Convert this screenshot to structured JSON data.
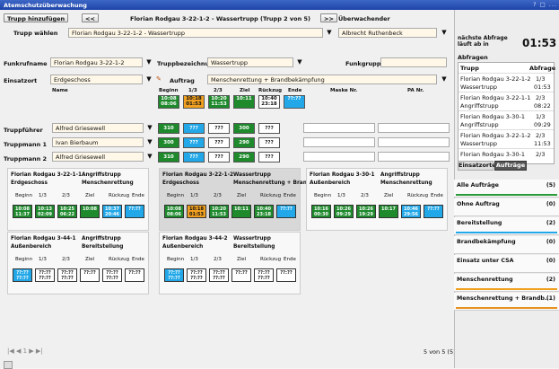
{
  "titlebar": {
    "title": "Atemschutzüberwachung",
    "controls": "? □ ..."
  },
  "toolbar": {
    "add_troop": "Trupp hinzufügen",
    "prev": "<<",
    "next": ">>",
    "current": "Florian Rodgau 3-22-1-2 - Wassertrupp (Trupp 2 von 5)",
    "monitor_label": "Überwachender"
  },
  "select": {
    "label": "Trupp wählen",
    "value": "Florian Rodgau 3-22-1-2 - Wassertrupp",
    "monitor": "Albrecht Ruthenbeck"
  },
  "form": {
    "funkrufname_label": "Funkrufname",
    "funkrufname": "Florian Rodgau 3-22-1-2",
    "truppbez_label": "Truppbezeichnung",
    "truppbez": "Wassertrupp",
    "funkgruppe_label": "Funkgruppe",
    "funkgruppe": "",
    "einsatzort_label": "Einsatzort",
    "einsatzort": "Erdgeschoss",
    "auftrag_label": "Auftrag",
    "auftrag": "Menschenrettung + Brandbekämpfung"
  },
  "table_header": {
    "name": "Name",
    "beginn": "Beginn",
    "c13": "1/3",
    "c23": "2/3",
    "ziel": "Ziel",
    "rueckzug": "Rückzug",
    "ende": "Ende",
    "maske": "Maske Nr.",
    "pa": "PA Nr."
  },
  "members": [
    {
      "role": "Truppführer",
      "name": "Alfred Griesewell",
      "value": "310",
      "cells": [
        "???",
        "???",
        "300",
        "???"
      ]
    },
    {
      "role": "Truppmann 1",
      "name": "Ivan Bierbaum",
      "value": "300",
      "cells": [
        "???",
        "???",
        "290",
        "???"
      ]
    },
    {
      "role": "Truppmann 2",
      "name": "Alfred Griesewell",
      "value": "310",
      "cells": [
        "???",
        "???",
        "290",
        "???"
      ]
    }
  ],
  "times": {
    "beginn": [
      "10:08",
      "08:06"
    ],
    "t13": [
      "10:18",
      "01:53"
    ],
    "t23": [
      "10:20",
      "11:53"
    ],
    "ziel": [
      "10:11",
      ""
    ],
    "rueckzug": [
      "10:40",
      "23:18"
    ],
    "ende": [
      "??:??",
      ""
    ]
  },
  "card_labels": {
    "beginn": "Beginn",
    "c13": "1/3",
    "c23": "2/3",
    "ziel": "Ziel",
    "rueckzug": "Rückzug",
    "ende": "Ende"
  },
  "cards": [
    {
      "name": "Florian Rodgau 3-22-1-1",
      "type": "Angriffstrupp",
      "ort": "Erdgeschoss",
      "auftrag": "Menschenrettung",
      "cells": [
        [
          "10:08",
          "11:37"
        ],
        [
          "10:13",
          "02:09"
        ],
        [
          "10:25",
          "06:22"
        ],
        [
          "10:08",
          ""
        ],
        [
          "10:37",
          "20:46"
        ],
        [
          "??:??",
          ""
        ]
      ]
    },
    {
      "name": "Florian Rodgau 3-22-1-2",
      "type": "Wassertrupp",
      "ort": "Erdgeschoss",
      "auftrag": "Menschenrettung + Bran...",
      "cells": [
        [
          "10:08",
          "08:06"
        ],
        [
          "10:18",
          "01:53"
        ],
        [
          "10:20",
          "11:53"
        ],
        [
          "10:11",
          ""
        ],
        [
          "10:40",
          "23:18"
        ],
        [
          "??:??",
          ""
        ]
      ]
    },
    {
      "name": "Florian Rodgau 3-30-1",
      "type": "Angriffstrupp",
      "ort": "Außenbereich",
      "auftrag": "Menschenrettung",
      "cells": [
        [
          "10:16",
          "00:30"
        ],
        [
          "10:26",
          "09:29"
        ],
        [
          "10:26",
          "19:29"
        ],
        [
          "10:17",
          ""
        ],
        [
          "10:46",
          "29:56"
        ],
        [
          "??:??",
          ""
        ]
      ]
    },
    {
      "name": "Florian Rodgau 3-44-1",
      "type": "Angriffstrupp",
      "ort": "Außenbereich",
      "auftrag": "Bereitstellung",
      "cells": [
        [
          "??:??",
          "??:??"
        ],
        [
          "??:??",
          "??:??"
        ],
        [
          "??:??",
          "??:??"
        ],
        [
          "??:??",
          ""
        ],
        [
          "??:??",
          "??:??"
        ],
        [
          "??:??",
          ""
        ]
      ]
    },
    {
      "name": "Florian Rodgau 3-44-2",
      "type": "Wassertrupp",
      "ort": "Außenbereich",
      "auftrag": "Bereitstellung",
      "cells": [
        [
          "??:??",
          "??:??"
        ],
        [
          "??:??",
          "??:??"
        ],
        [
          "??:??",
          "??:??"
        ],
        [
          "??:??",
          ""
        ],
        [
          "??:??",
          "??:??"
        ],
        [
          "??:??",
          ""
        ]
      ]
    }
  ],
  "pager": {
    "text": "5 von 5 (5)"
  },
  "right": {
    "next_label": "nächste Abfrage läuft ab in",
    "next_time": "01:53",
    "abfragen_title": "Abfragen",
    "col_trupp": "Trupp",
    "col_abfrage": "Abfrage",
    "rows": [
      {
        "t1": "Florian Rodgau 3-22-1-2",
        "t2": "Wassertrupp",
        "a1": "1/3",
        "a2": "01:53"
      },
      {
        "t1": "Florian Rodgau 3-22-1-1",
        "t2": "Angriffstrupp",
        "a1": "2/3",
        "a2": "08:22"
      },
      {
        "t1": "Florian Rodgau 3-30-1",
        "t2": "Angriffstrupp",
        "a1": "1/3",
        "a2": "09:29"
      },
      {
        "t1": "Florian Rodgau 3-22-1-2",
        "t2": "Wassertrupp",
        "a1": "2/3",
        "a2": "11:53"
      },
      {
        "t1": "Florian Rodgau 3-30-1",
        "t2": "",
        "a1": "2/3",
        "a2": ""
      }
    ],
    "tab1": "Einsatzorte",
    "tab2": "Aufträge",
    "groups": [
      {
        "label": "Alle Aufträge",
        "count": "(5)",
        "color": "#2a9a3a"
      },
      {
        "label": "Ohne Auftrag",
        "count": "(0)",
        "color": ""
      },
      {
        "label": "Bereitstellung",
        "count": "(2)",
        "color": "#22a8e8"
      },
      {
        "label": "Brandbekämpfung",
        "count": "(0)",
        "color": ""
      },
      {
        "label": "Einsatz unter CSA",
        "count": "(0)",
        "color": ""
      },
      {
        "label": "Menschenrettung",
        "count": "(2)",
        "color": "#f0a020"
      },
      {
        "label": "Menschenrettung + Brandb...",
        "count": "(1)",
        "color": "#e89020"
      }
    ]
  }
}
